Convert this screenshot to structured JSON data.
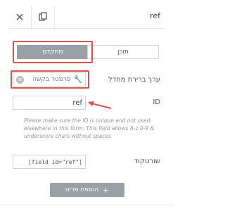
{
  "topbar": {
    "title": "ref",
    "close_icon": "close-icon",
    "duplicate_icon": "duplicate-icon"
  },
  "tabs": [
    {
      "label": "מתקדם",
      "active": true
    },
    {
      "label": "תוכן",
      "active": false
    }
  ],
  "default_value": {
    "label": "ערך ברירת מחדל",
    "placeholder": "פרמטר בקשה",
    "icons": [
      "wrench-icon",
      "clear-circle-icon"
    ]
  },
  "id_field": {
    "label": "ID",
    "value": "ref"
  },
  "hint": "Please make sure the ID is unique and not used elsewhere in this form. This field allows A-z 0-9 & underscore chars without spaces",
  "shortcode": {
    "label": "שורטקוד",
    "value": "[field id=\"ref\"]"
  },
  "add_button": {
    "label": "הוספת פריט",
    "icon": "plus-icon"
  },
  "colors": {
    "highlight": "#d9534f",
    "active_tab": "#9aa0a6",
    "button": "#9aa0a6"
  }
}
